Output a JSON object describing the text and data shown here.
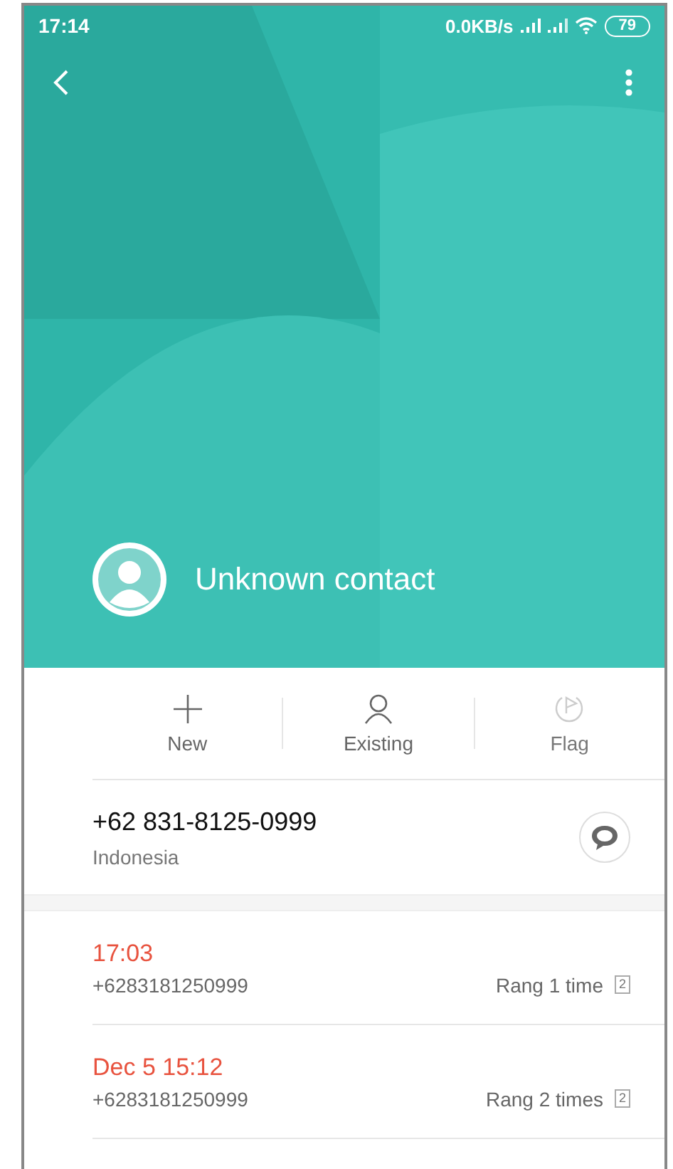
{
  "status_bar": {
    "time": "17:14",
    "network_speed": "0.0KB/s",
    "battery": "79"
  },
  "contact": {
    "name": "Unknown contact"
  },
  "actions": [
    {
      "kind": "new",
      "label": "New",
      "disabled": false
    },
    {
      "kind": "existing",
      "label": "Existing",
      "disabled": false
    },
    {
      "kind": "flag",
      "label": "Flag",
      "disabled": true
    }
  ],
  "number": {
    "value": "+62 831-8125-0999",
    "region": "Indonesia"
  },
  "calls": [
    {
      "time": "17:03",
      "number": "+6283181250999",
      "summary": "Rang 1 time",
      "sim": "2",
      "missed": true
    },
    {
      "time": "Dec 5 15:12",
      "number": "+6283181250999",
      "summary": "Rang 2 times",
      "sim": "2",
      "missed": true
    }
  ]
}
